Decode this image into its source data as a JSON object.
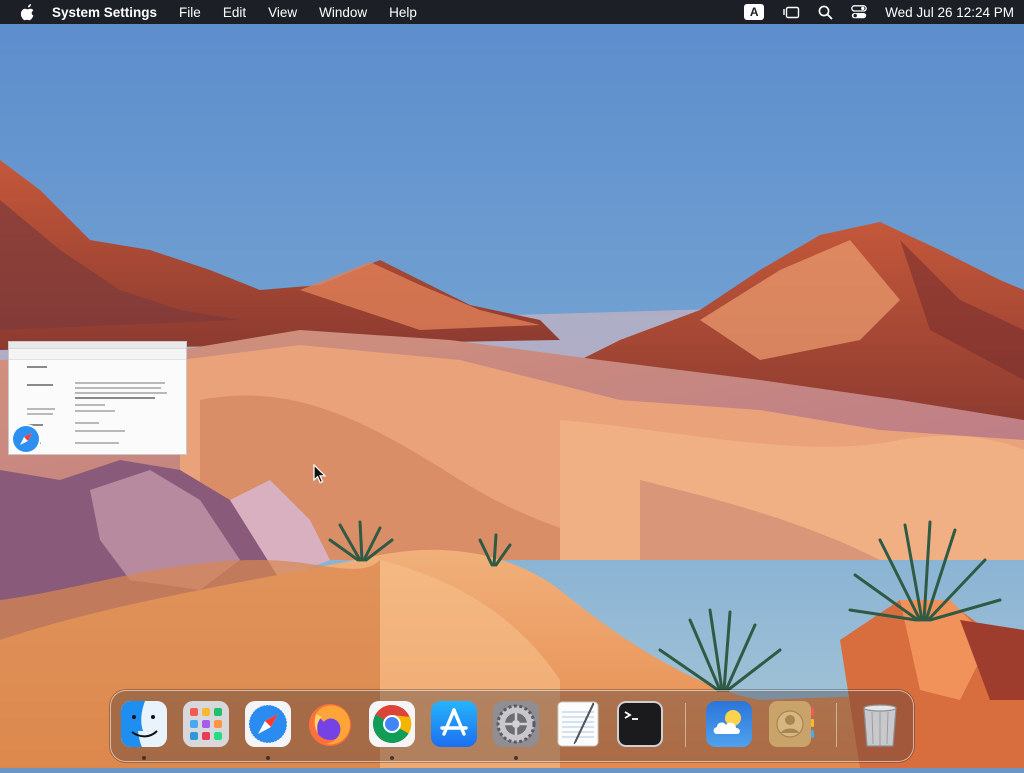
{
  "menubar": {
    "app_name": "System Settings",
    "menus": [
      "File",
      "Edit",
      "View",
      "Window",
      "Help"
    ],
    "input_source_label": "A",
    "clock": "Wed Jul 26  12:24 PM",
    "icons": [
      "apple-icon",
      "input-source-icon",
      "stage-manager-icon",
      "spotlight-search-icon",
      "control-center-icon"
    ]
  },
  "dock": {
    "apps": [
      {
        "name": "Finder",
        "icon": "finder-icon",
        "running": true
      },
      {
        "name": "Launchpad",
        "icon": "launchpad-icon",
        "running": false
      },
      {
        "name": "Safari",
        "icon": "safari-icon",
        "running": true
      },
      {
        "name": "Firefox",
        "icon": "firefox-icon",
        "running": false
      },
      {
        "name": "Google Chrome",
        "icon": "chrome-icon",
        "running": true
      },
      {
        "name": "App Store",
        "icon": "app-store-icon",
        "running": false
      },
      {
        "name": "System Settings",
        "icon": "system-settings-icon",
        "running": true
      },
      {
        "name": "TextEdit",
        "icon": "textedit-icon",
        "running": false
      },
      {
        "name": "Terminal",
        "icon": "terminal-icon",
        "running": false
      },
      {
        "name": "Weather",
        "icon": "weather-icon",
        "running": false
      },
      {
        "name": "Contacts",
        "icon": "contacts-icon",
        "running": false
      },
      {
        "name": "Trash",
        "icon": "trash-icon",
        "running": false
      }
    ]
  },
  "colors": {
    "menubar_bg": "#1d1f26",
    "sky_top": "#5c8ccc",
    "sky_bottom": "#9cc3d8",
    "sand": "#e99a5c"
  }
}
